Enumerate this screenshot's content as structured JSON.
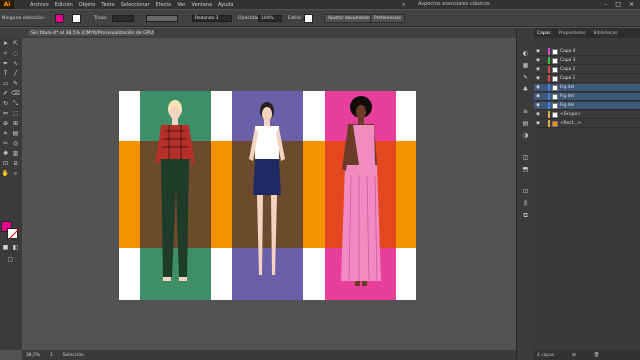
{
  "app": {
    "logo": "Ai",
    "workspace": "Aspectos esenciales clásicos"
  },
  "menu": [
    "Archivo",
    "Edición",
    "Objeto",
    "Texto",
    "Seleccionar",
    "Efecto",
    "Ver",
    "Ventana",
    "Ayuda"
  ],
  "controlbar": {
    "selection_label": "Ninguna selección",
    "stroke_label": "Trazo:",
    "stroke_value": "",
    "brush_value": "Redondo 3",
    "opacity_label": "Opacidad:",
    "opacity_value": "100%",
    "style_label": "Estilo:",
    "doc_setup": "Ajustar documento",
    "prefs": "Preferencias",
    "fill_color": "#ec008c",
    "accent_orange": "#ff9a00"
  },
  "document": {
    "tab": "Sin título-4* al 38,5% (CMYK/Previsualización de GPU)"
  },
  "artboard": {
    "background": "#ffffff",
    "band_color": "#f39200",
    "columns": [
      {
        "name": "green",
        "color": "#3e8e68",
        "band": "#6b4a2d"
      },
      {
        "name": "violet",
        "color": "#6a5fa8",
        "band": "#6b4a2d"
      },
      {
        "name": "pink",
        "color": "#e83e9c",
        "band": "#e4461f"
      }
    ]
  },
  "status": {
    "zoom": "38,5%",
    "page": "1",
    "tool": "Selección"
  },
  "layers_panel": {
    "tabs": [
      "Capas",
      "Propiedades",
      "Bibliotecas"
    ],
    "rows": [
      {
        "label": "Capa 4",
        "color": "#d14bd1",
        "selected": false
      },
      {
        "label": "Capa 3",
        "color": "#41c441",
        "selected": false
      },
      {
        "label": "Capa 2",
        "color": "#e04a4a",
        "selected": false
      },
      {
        "label": "Capa 1",
        "color": "#e04a4a",
        "selected": false
      },
      {
        "label": "Fig.del",
        "color": "#4a7de0",
        "selected": true
      },
      {
        "label": "Fig.del",
        "color": "#4a7de0",
        "selected": true
      },
      {
        "label": "Fig.del",
        "color": "#4a7de0",
        "selected": true
      },
      {
        "label": "<Grupo>",
        "color": "#e0b04a",
        "selected": false
      },
      {
        "label": "<Rect...>",
        "color": "#e0b04a",
        "selected": false
      }
    ],
    "footer": "4 capas"
  }
}
